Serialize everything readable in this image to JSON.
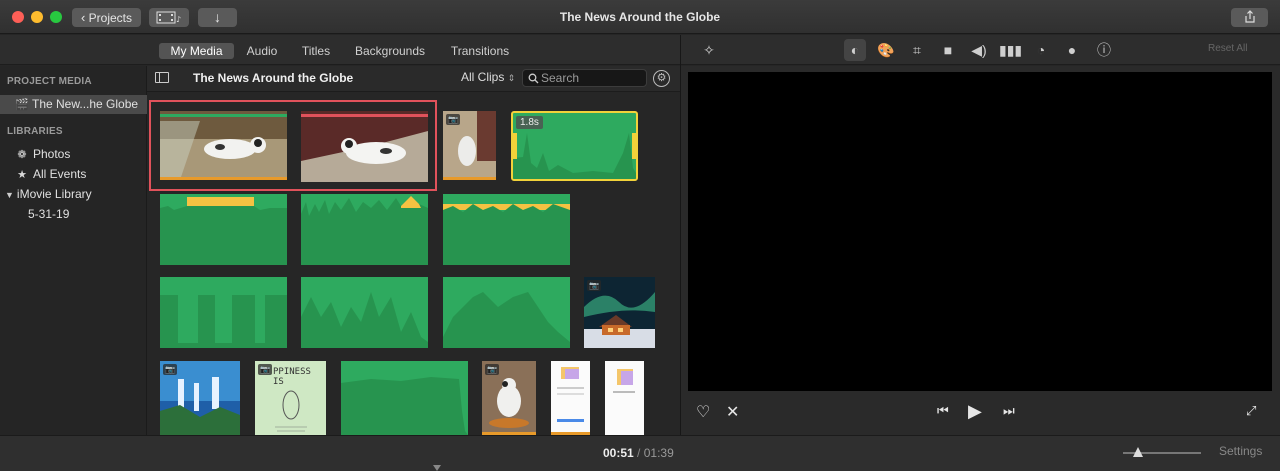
{
  "window": {
    "title": "The News Around the Globe"
  },
  "toolbar": {
    "projects_label": "Projects"
  },
  "tabs": [
    "My Media",
    "Audio",
    "Titles",
    "Backgrounds",
    "Transitions"
  ],
  "sidebar": {
    "project_media_header": "PROJECT MEDIA",
    "project_item": "The New...he Globe",
    "libraries_header": "LIBRARIES",
    "items": [
      {
        "label": "Photos",
        "icon": "flower-icon"
      },
      {
        "label": "All Events",
        "icon": "star-icon"
      },
      {
        "label": "iMovie Library",
        "icon": "disclosure-triangle-icon"
      },
      {
        "label": "5-31-19",
        "icon": ""
      }
    ]
  },
  "browser": {
    "title": "The News Around the Globe",
    "filter": "All Clips",
    "search_placeholder": "Search",
    "clip_duration_badge": "1.8s",
    "happiness_text": "PPINESS IS"
  },
  "viewer": {
    "reset_all": "Reset All"
  },
  "bottom": {
    "current_time": "00:51",
    "separator": "/",
    "total_time": "01:39",
    "settings_label": "Settings"
  },
  "colors": {
    "clip_green": "#2eaa5f",
    "selection_red": "#e0525b",
    "selection_yellow": "#f2d23a",
    "audio_orange": "#e89a2a"
  }
}
